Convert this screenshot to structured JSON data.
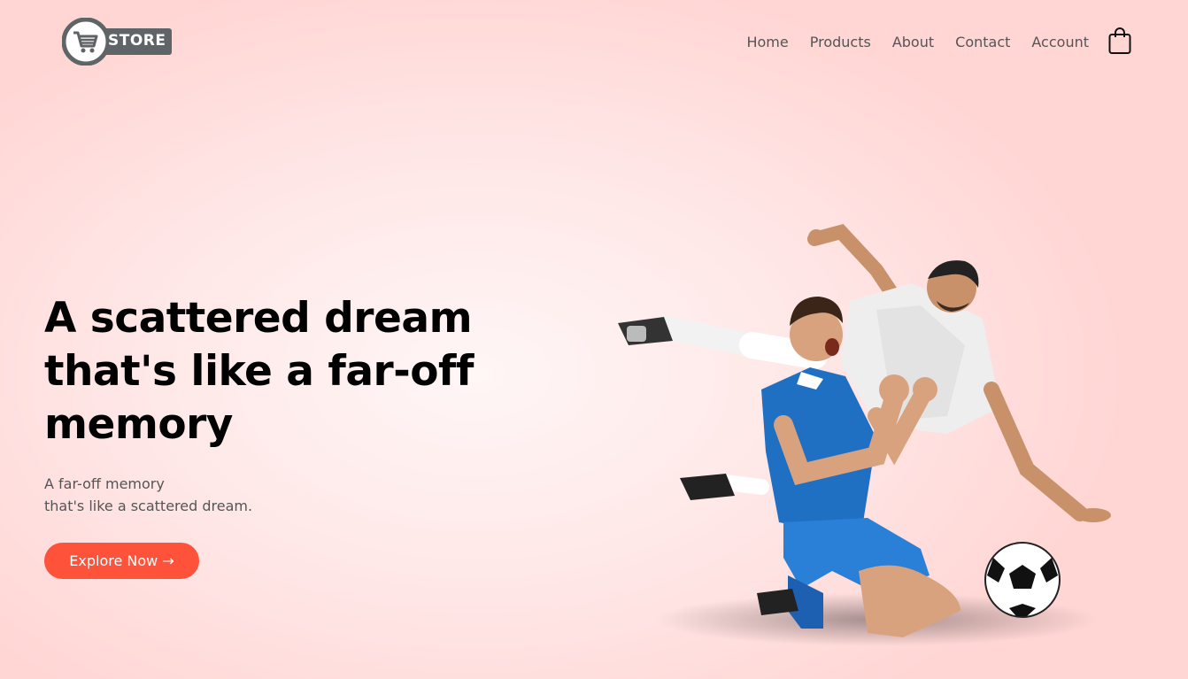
{
  "header": {
    "logo_text": "STORE",
    "nav": [
      "Home",
      "Products",
      "About",
      "Contact",
      "Account"
    ],
    "cart_icon": "shopping-bag-icon"
  },
  "hero": {
    "title": "A scattered dream that's like a far-off memory",
    "subtitle_line1": "A far-off memory",
    "subtitle_line2": "that's like a scattered dream.",
    "cta_label": "Explore Now →",
    "image": "soccer-players-image"
  },
  "colors": {
    "accent": "#ff523b",
    "logo_gray": "#5f6466",
    "background": "#ffe6e6"
  }
}
